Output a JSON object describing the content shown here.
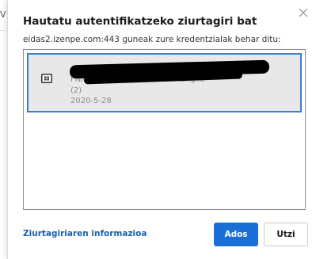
{
  "edge": {
    "char": "V"
  },
  "dialog": {
    "title": "Hautatu autentifikatzeko ziurtagiri bat",
    "subtitle": "eidas2.izenpe.com:443 guneak zure kredentzialak behar ditu:",
    "close_icon": "close-icon",
    "certificates": [
      {
        "icon": "certificate-icon",
        "name": "FNMT-RCM, Alda FNMTlako langile",
        "suffix": "(2)",
        "date": "2020-5-28",
        "selected": true
      }
    ],
    "info_link": "Ziurtagiriaren informazioa",
    "ok_label": "Ados",
    "cancel_label": "Utzi"
  },
  "colors": {
    "accent": "#1a6fd6",
    "selection_border": "#3b7ed6",
    "link": "#1a5fb4"
  }
}
